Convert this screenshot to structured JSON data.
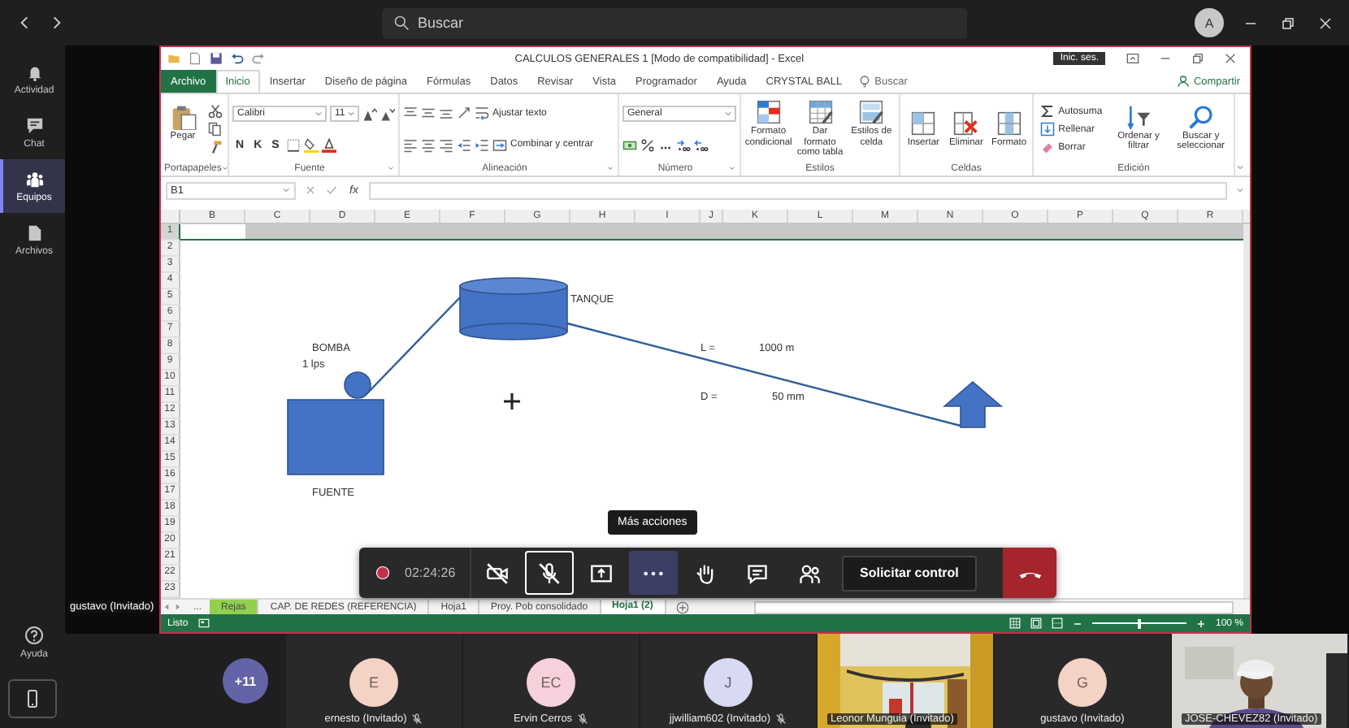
{
  "topbar": {
    "search": {
      "placeholder": "Buscar"
    },
    "avatar": "A"
  },
  "rail": {
    "items": [
      {
        "label": "Actividad",
        "kind": "bell",
        "selected": false
      },
      {
        "label": "Chat",
        "kind": "chat",
        "selected": false
      },
      {
        "label": "Equipos",
        "kind": "teams",
        "selected": true
      },
      {
        "label": "Archivos",
        "kind": "file",
        "selected": false
      }
    ],
    "help": "Ayuda"
  },
  "stage_label": "gustavo (Invitado)",
  "excel": {
    "title": "CALCULOS GENERALES 1  [Modo de compatibilidad]  -  Excel",
    "sign_in": "Inic. ses.",
    "file_tab": "Archivo",
    "tabs": [
      {
        "label": "Inicio",
        "selected": true
      },
      {
        "label": "Insertar",
        "selected": false
      },
      {
        "label": "Diseño de página",
        "selected": false
      },
      {
        "label": "Fórmulas",
        "selected": false
      },
      {
        "label": "Datos",
        "selected": false
      },
      {
        "label": "Revisar",
        "selected": false
      },
      {
        "label": "Vista",
        "selected": false
      },
      {
        "label": "Programador",
        "selected": false
      },
      {
        "label": "Ayuda",
        "selected": false
      },
      {
        "label": "CRYSTAL BALL",
        "selected": false
      }
    ],
    "tell_me": "Buscar",
    "share": "Compartir",
    "groups": [
      {
        "label": "Portapapeles",
        "launcher": true,
        "rows": [
          {
            "items": [
              {
                "kind": "paste",
                "label": "Pegar"
              },
              {
                "kind": "stack",
                "items": [
                  {
                    "kind": "cut"
                  },
                  {
                    "kind": "copy"
                  },
                  {
                    "kind": "painter"
                  }
                ]
              }
            ]
          }
        ]
      },
      {
        "label": "Fuente",
        "launcher": true,
        "rows": [
          {
            "items": [
              {
                "kind": "combo",
                "value": "Calibri"
              },
              {
                "kind": "combo",
                "value": "11"
              },
              {
                "kind": "grow"
              },
              {
                "kind": "shrink"
              }
            ]
          },
          {
            "items": [
              {
                "kind": "glyph",
                "label": "N"
              },
              {
                "kind": "glyph",
                "label": "K"
              },
              {
                "kind": "glyph",
                "label": "S"
              },
              {
                "kind": "borders"
              },
              {
                "kind": "fill-color"
              },
              {
                "kind": "font-color"
              }
            ]
          }
        ]
      },
      {
        "label": "Alineación",
        "launcher": true,
        "rows": [
          {
            "items": [
              {
                "kind": "align-top"
              },
              {
                "kind": "align-middle"
              },
              {
                "kind": "align-bottom"
              },
              {
                "kind": "orientation"
              },
              {
                "kind": "wrap",
                "label": "Ajustar texto"
              }
            ]
          },
          {
            "items": [
              {
                "kind": "align-left"
              },
              {
                "kind": "align-center"
              },
              {
                "kind": "align-right"
              },
              {
                "kind": "outdent"
              },
              {
                "kind": "indent"
              },
              {
                "kind": "merge",
                "label": "Combinar y centrar"
              }
            ]
          }
        ]
      },
      {
        "label": "Número",
        "launcher": true,
        "rows": [
          {
            "items": [
              {
                "kind": "combo",
                "value": "General"
              }
            ]
          },
          {
            "items": [
              {
                "kind": "currency"
              },
              {
                "kind": "percent"
              },
              {
                "kind": "thousands"
              },
              {
                "kind": "inc-decimal"
              },
              {
                "kind": "dec-decimal"
              }
            ]
          }
        ]
      },
      {
        "label": "Estilos",
        "launcher": false,
        "rows": [
          {
            "items": [
              {
                "kind": "conditional",
                "label": "Formato condicional"
              },
              {
                "kind": "table",
                "label": "Dar formato como tabla"
              },
              {
                "kind": "styles",
                "label": "Estilos de celda"
              }
            ]
          }
        ]
      },
      {
        "label": "Celdas",
        "launcher": false,
        "rows": [
          {
            "items": [
              {
                "kind": "insert",
                "label": "Insertar"
              },
              {
                "kind": "delete",
                "label": "Eliminar"
              },
              {
                "kind": "format",
                "label": "Formato"
              }
            ]
          }
        ]
      },
      {
        "label": "Edición",
        "launcher": false,
        "rows": [
          {
            "items": [
              {
                "kind": "stack",
                "items": [
                  {
                    "kind": "autosum",
                    "label": "Autosuma"
                  },
                  {
                    "kind": "fill-down",
                    "label": "Rellenar"
                  },
                  {
                    "kind": "clear",
                    "label": "Borrar"
                  }
                ]
              },
              {
                "kind": "sort",
                "label": "Ordenar y filtrar"
              },
              {
                "kind": "find",
                "label": "Buscar y seleccionar"
              }
            ]
          }
        ]
      }
    ],
    "name_box": "B1",
    "function_label": "fx",
    "columns": [
      "B",
      "C",
      "D",
      "E",
      "F",
      "G",
      "H",
      "I",
      "J",
      "K",
      "L",
      "M",
      "N",
      "O",
      "P",
      "Q",
      "R"
    ],
    "rows": [
      {
        "label": "1",
        "selected": true
      },
      {
        "label": "2",
        "selected": false
      },
      {
        "label": "3",
        "selected": false
      },
      {
        "label": "4",
        "selected": false
      },
      {
        "label": "5",
        "selected": false
      },
      {
        "label": "6",
        "selected": false
      },
      {
        "label": "7",
        "selected": false
      },
      {
        "label": "8",
        "selected": false
      },
      {
        "label": "9",
        "selected": false
      },
      {
        "label": "10",
        "selected": false
      },
      {
        "label": "11",
        "selected": false
      },
      {
        "label": "12",
        "selected": false
      },
      {
        "label": "13",
        "selected": false
      },
      {
        "label": "14",
        "selected": false
      },
      {
        "label": "15",
        "selected": false
      },
      {
        "label": "16",
        "selected": false
      },
      {
        "label": "17",
        "selected": false
      },
      {
        "label": "18",
        "selected": false
      },
      {
        "label": "19",
        "selected": false
      },
      {
        "label": "20",
        "selected": false
      },
      {
        "label": "21",
        "selected": false
      },
      {
        "label": "22",
        "selected": false
      },
      {
        "label": "23",
        "selected": false
      }
    ],
    "drawing": {
      "labels": [
        "TANQUE",
        "BOMBA",
        "1 lps",
        "FUENTE",
        "L =",
        "1000 m",
        "D =",
        "50 mm"
      ]
    },
    "sheets": {
      "overflow": "...",
      "tabs": [
        {
          "label": "Rejas",
          "color": "#92d050",
          "selected": false
        },
        {
          "label": "CAP. DE REDES (REFERENCIA)",
          "selected": false
        },
        {
          "label": "Hoja1",
          "selected": false
        },
        {
          "label": "Proy. Pob consolidado",
          "selected": false
        },
        {
          "label": "Hoja1 (2)",
          "selected": true
        }
      ]
    },
    "status": {
      "text": "Listo",
      "zoom": "100 %",
      "zoom_slider": {
        "level": 0.5
      }
    }
  },
  "call": {
    "recording": true,
    "timer": "02:24:26",
    "tools": [
      {
        "kind": "camera",
        "off": true,
        "focused": false,
        "hovered": false
      },
      {
        "kind": "microphone",
        "off": true,
        "focused": true,
        "hovered": false
      },
      {
        "kind": "share",
        "off": false,
        "focused": false,
        "hovered": false
      },
      {
        "kind": "more",
        "off": false,
        "focused": false,
        "hovered": true
      },
      {
        "kind": "hand",
        "off": false,
        "focused": false,
        "hovered": false
      },
      {
        "kind": "chat",
        "off": false,
        "focused": false,
        "hovered": false
      },
      {
        "kind": "people",
        "off": false,
        "focused": false,
        "hovered": false
      }
    ],
    "request": "Solicitar control",
    "tooltip": "Más acciones"
  },
  "participants": [
    {
      "kind": "overflow",
      "label": "+11"
    },
    {
      "kind": "avatar",
      "name": "ernesto (Invitado)",
      "initials": "E",
      "color": "#f4d2c6",
      "muted": true
    },
    {
      "kind": "avatar",
      "name": "Ervin Cerros",
      "initials": "EC",
      "color": "#f6d0da",
      "muted": true
    },
    {
      "kind": "avatar",
      "name": "jjwilliam602 (Invitado)",
      "initials": "J",
      "color": "#d8d9f3",
      "muted": true
    },
    {
      "kind": "video",
      "name": "Leonor Munguia (Invitado)",
      "muted": false
    },
    {
      "kind": "avatar",
      "name": "gustavo (Invitado)",
      "initials": "G",
      "color": "#f4d2c6",
      "muted": false
    },
    {
      "kind": "video",
      "name": "JOSE-CHEVEZ82 (Invitado)",
      "muted": false
    }
  ]
}
